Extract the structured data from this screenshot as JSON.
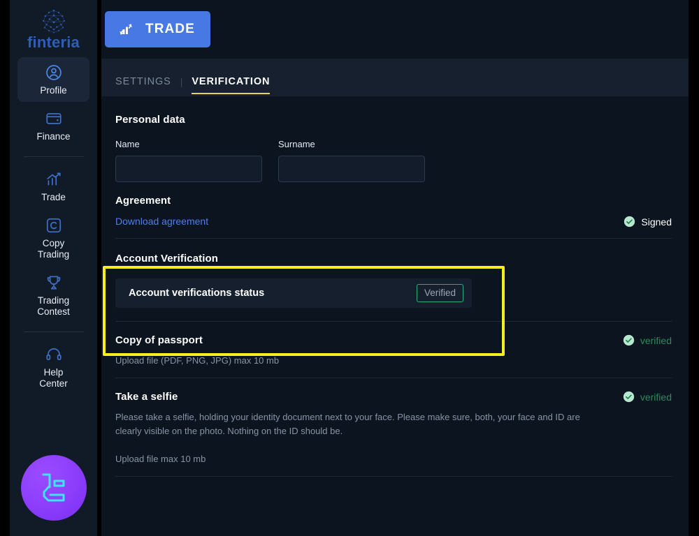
{
  "brand": {
    "name": "finteria",
    "logo_icon": "network-globe-icon"
  },
  "sidebar": {
    "items": [
      {
        "label": "Profile",
        "icon": "user-circle-icon",
        "active": true
      },
      {
        "label": "Finance",
        "icon": "wallet-icon",
        "active": false
      },
      {
        "label": "Trade",
        "icon": "chart-arrow-icon",
        "active": false
      },
      {
        "label": "Copy\nTrading",
        "icon": "copy-c-icon",
        "active": false
      },
      {
        "label": "Trading\nContest",
        "icon": "trophy-icon",
        "active": false
      },
      {
        "label": "Help\nCenter",
        "icon": "headset-icon",
        "active": false
      }
    ],
    "bottom_logo_icon": "purple-circle-l-logo"
  },
  "topbar": {
    "trade_button_label": "TRADE",
    "trade_button_icon": "trade-chart-icon",
    "trade_button_color": "#4878e3"
  },
  "tabs": {
    "settings_label": "SETTINGS",
    "divider": "|",
    "verification_label": "VERIFICATION",
    "active": "VERIFICATION",
    "active_underline_color": "#e8d44d"
  },
  "personal_data": {
    "title": "Personal data",
    "name_label": "Name",
    "name_value": "",
    "name_placeholder": "",
    "surname_label": "Surname",
    "surname_value": "",
    "surname_placeholder": ""
  },
  "agreement": {
    "title": "Agreement",
    "download_link": "Download agreement",
    "status_text": "Signed",
    "status_icon": "green-check-circle-icon"
  },
  "account_verification": {
    "title": "Account Verification",
    "status_row_label": "Account verifications status",
    "badge_label": "Verified",
    "badge_border_color": "#2eae72",
    "highlight_color": "#f5ef20"
  },
  "passport": {
    "title": "Copy of passport",
    "hint": "Upload file (PDF, PNG, JPG) max 10 mb",
    "status_text": "verified",
    "status_icon": "green-check-circle-icon"
  },
  "selfie": {
    "title": "Take a selfie",
    "hint": "Please take a selfie, holding your identity document next to your face. Please make sure, both, your face and ID are clearly visible on the photo. Nothing on the ID should be.",
    "hint2": "Upload file max 10 mb",
    "status_text": "verified",
    "status_icon": "green-check-circle-icon"
  }
}
